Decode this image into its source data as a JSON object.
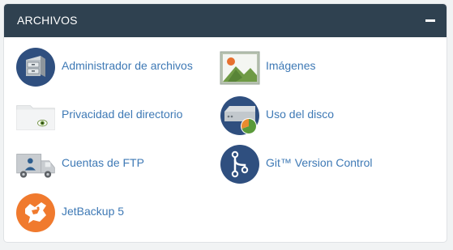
{
  "panel": {
    "title": "ARCHIVOS",
    "collapse_icon": "minus-icon",
    "header_color": "#2f4150",
    "link_color": "#3e79b5"
  },
  "items": [
    {
      "label": "Administrador de archivos",
      "icon": "file-manager-icon"
    },
    {
      "label": "Imágenes",
      "icon": "images-icon"
    },
    {
      "label": "Privacidad del directorio",
      "icon": "directory-privacy-icon"
    },
    {
      "label": "Uso del disco",
      "icon": "disk-usage-icon"
    },
    {
      "label": "Cuentas de FTP",
      "icon": "ftp-accounts-icon"
    },
    {
      "label": "Git™ Version Control",
      "icon": "git-version-control-icon"
    },
    {
      "label": "JetBackup 5",
      "icon": "jetbackup-icon"
    }
  ]
}
